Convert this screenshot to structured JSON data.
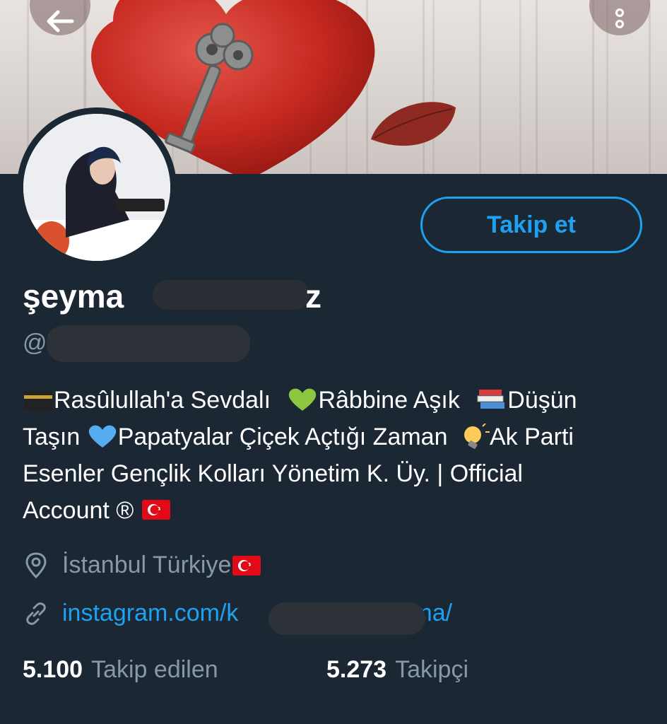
{
  "profile": {
    "display_name": "şeyma",
    "display_name_tail": "z",
    "handle_prefix": "@'",
    "follow_button_label": "Takip et",
    "bio": {
      "line1_a": "Rasûlullah'a Sevdalı",
      "line1_b": "Râbbine Aşık",
      "line1_c": "Düşün",
      "line2_a": "Taşın",
      "line2_b": "Papatyalar Çiçek Açtığı Zaman",
      "line2_c": "Ak Parti",
      "line3": "Esenler Gençlik Kolları Yönetim K. Üy. |  Official",
      "line4": "Account ®"
    },
    "location": "İstanbul Türkiye",
    "link_prefix": "instagram.com/k",
    "link_suffix": "ma/",
    "following_count": "5.100",
    "following_label": "Takip edilen",
    "followers_count": "5.273",
    "followers_label": "Takipçi"
  },
  "icons": {
    "back": "arrow-left-icon",
    "more": "more-vertical-icon",
    "location": "location-pin-icon",
    "link": "link-icon"
  },
  "colors": {
    "background": "#1b2733",
    "accent": "#1da1f2",
    "muted": "#8899a6"
  }
}
